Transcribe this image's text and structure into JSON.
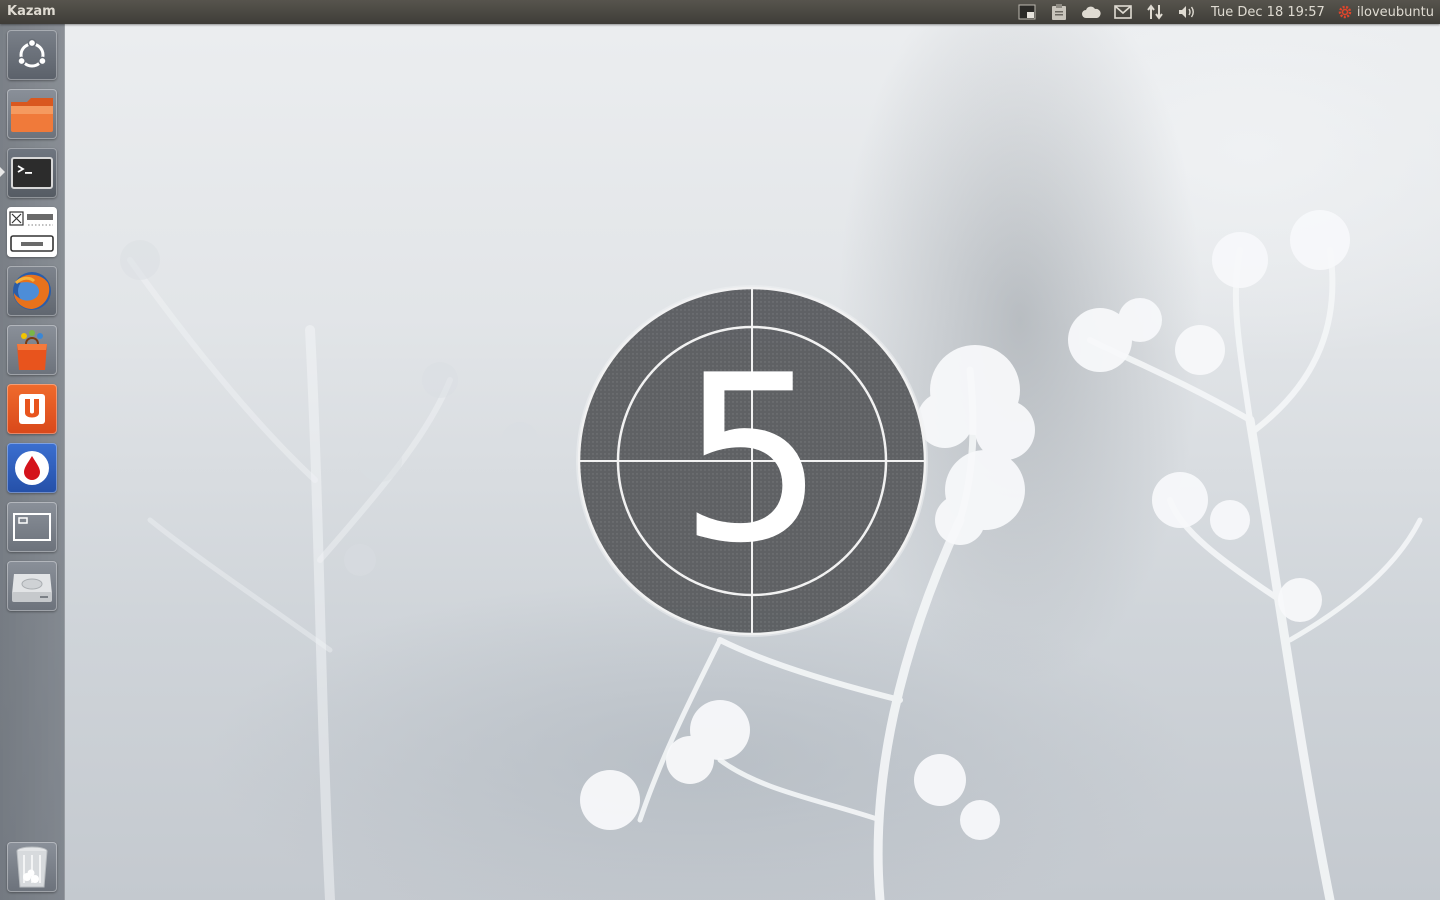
{
  "panel": {
    "app_title": "Kazam",
    "clock": "Tue Dec 18  19:57",
    "user": "iloveubuntu",
    "indicators": [
      "workspace-icon",
      "clipboard-icon",
      "cloud-icon",
      "mail-icon",
      "network-icon",
      "volume-icon"
    ]
  },
  "launcher": {
    "items": [
      {
        "name": "dash-home",
        "icon": "ubuntu-logo-icon"
      },
      {
        "name": "files",
        "icon": "folder-icon"
      },
      {
        "name": "terminal",
        "icon": "terminal-icon",
        "active": true
      },
      {
        "name": "glade",
        "icon": "ui-designer-icon"
      },
      {
        "name": "firefox",
        "icon": "firefox-icon"
      },
      {
        "name": "software-center",
        "icon": "shopping-bag-icon"
      },
      {
        "name": "ubuntu-one",
        "icon": "ubuntu-one-icon"
      },
      {
        "name": "drop",
        "icon": "drop-icon"
      },
      {
        "name": "workspaces",
        "icon": "workspace-switcher-icon"
      },
      {
        "name": "drive",
        "icon": "hard-drive-icon"
      }
    ],
    "trash": {
      "name": "trash",
      "icon": "trash-icon"
    }
  },
  "countdown": {
    "value": "5"
  },
  "colors": {
    "panel_bg": "#3f3d38",
    "panel_text": "#dfdbd2",
    "session_accent": "#e2452b",
    "countdown_bg": "#55575a"
  }
}
